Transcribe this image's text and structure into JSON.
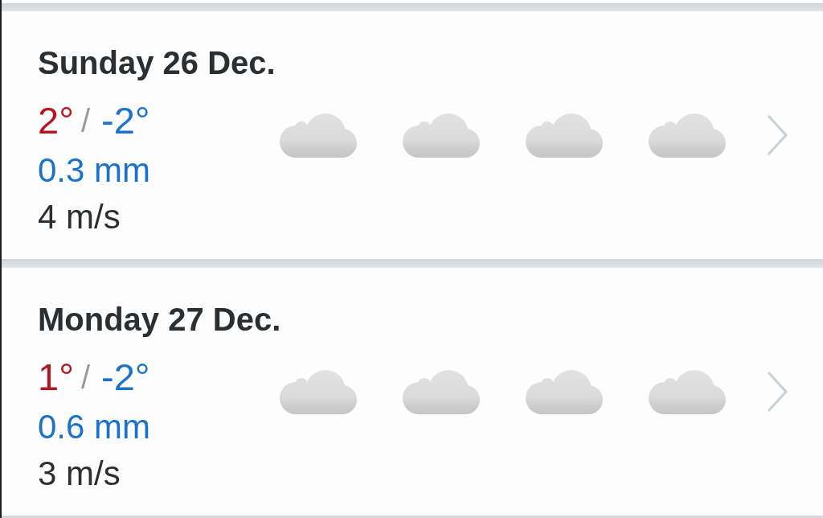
{
  "days": [
    {
      "date": "Sunday 26 Dec.",
      "high": "2°",
      "separator": "/",
      "low": "-2°",
      "precipitation": "0.3 mm",
      "wind": "4 m/s"
    },
    {
      "date": "Monday 27 Dec.",
      "high": "1°",
      "separator": "/",
      "low": "-2°",
      "precipitation": "0.6 mm",
      "wind": "3 m/s"
    }
  ]
}
